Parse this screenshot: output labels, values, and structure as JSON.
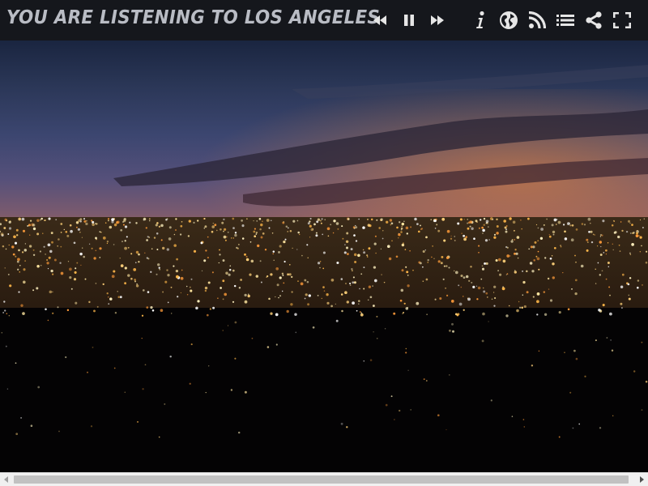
{
  "header": {
    "title": "YOU ARE LISTENING TO LOS ANGELES"
  },
  "controls": [
    {
      "name": "rewind-icon",
      "label": "Rewind"
    },
    {
      "name": "pause-icon",
      "label": "Pause"
    },
    {
      "name": "fast-forward-icon",
      "label": "Fast forward"
    },
    {
      "name": "info-icon",
      "label": "Info"
    },
    {
      "name": "globe-icon",
      "label": "Choose city"
    },
    {
      "name": "rss-icon",
      "label": "Feed"
    },
    {
      "name": "list-icon",
      "label": "List"
    },
    {
      "name": "share-icon",
      "label": "Share"
    },
    {
      "name": "fullscreen-icon",
      "label": "Fullscreen"
    }
  ],
  "colors": {
    "topbar_bg": "#15171c",
    "title": "#b9bcc4",
    "icon": "#e6e6e6"
  },
  "background": {
    "subject": "night-city-skyline-photo"
  },
  "scrollbar": {
    "left_arrow": "scroll-left-icon",
    "right_arrow": "scroll-right-icon"
  }
}
